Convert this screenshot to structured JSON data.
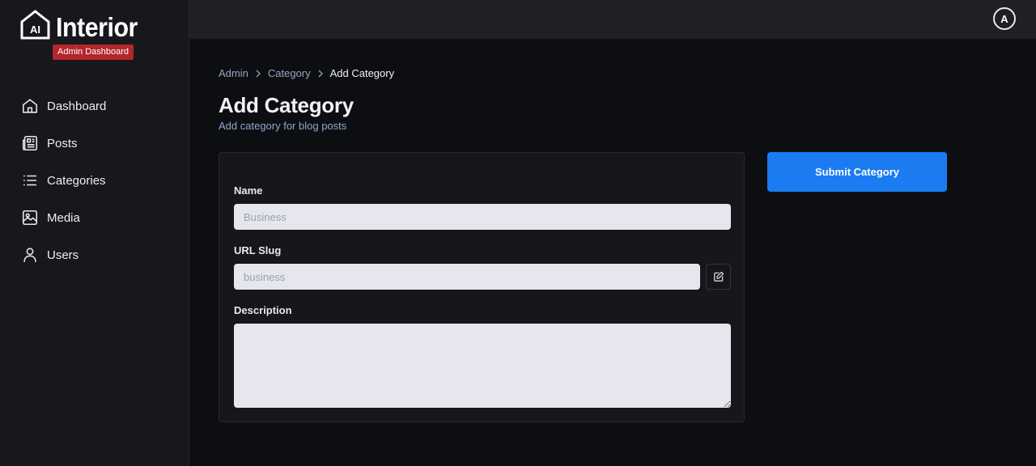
{
  "brand": {
    "logo_mark": "AI",
    "name": "Interior",
    "badge": "Admin Dashboard",
    "badge_color": "#b3262c"
  },
  "sidebar": {
    "items": [
      {
        "label": "Dashboard",
        "icon": "home-icon"
      },
      {
        "label": "Posts",
        "icon": "newspaper-icon"
      },
      {
        "label": "Categories",
        "icon": "list-icon"
      },
      {
        "label": "Media",
        "icon": "image-icon"
      },
      {
        "label": "Users",
        "icon": "user-icon"
      }
    ]
  },
  "header": {
    "avatar_initial": "A"
  },
  "breadcrumb": {
    "items": [
      "Admin",
      "Category",
      "Add Category"
    ]
  },
  "page": {
    "title": "Add Category",
    "subtitle": "Add category for blog posts"
  },
  "form": {
    "name_label": "Name",
    "name_placeholder": "Business",
    "name_value": "",
    "slug_label": "URL Slug",
    "slug_placeholder": "business",
    "slug_value": "",
    "description_label": "Description",
    "description_value": ""
  },
  "actions": {
    "submit_label": "Submit Category",
    "submit_color": "#1a7cf0"
  }
}
